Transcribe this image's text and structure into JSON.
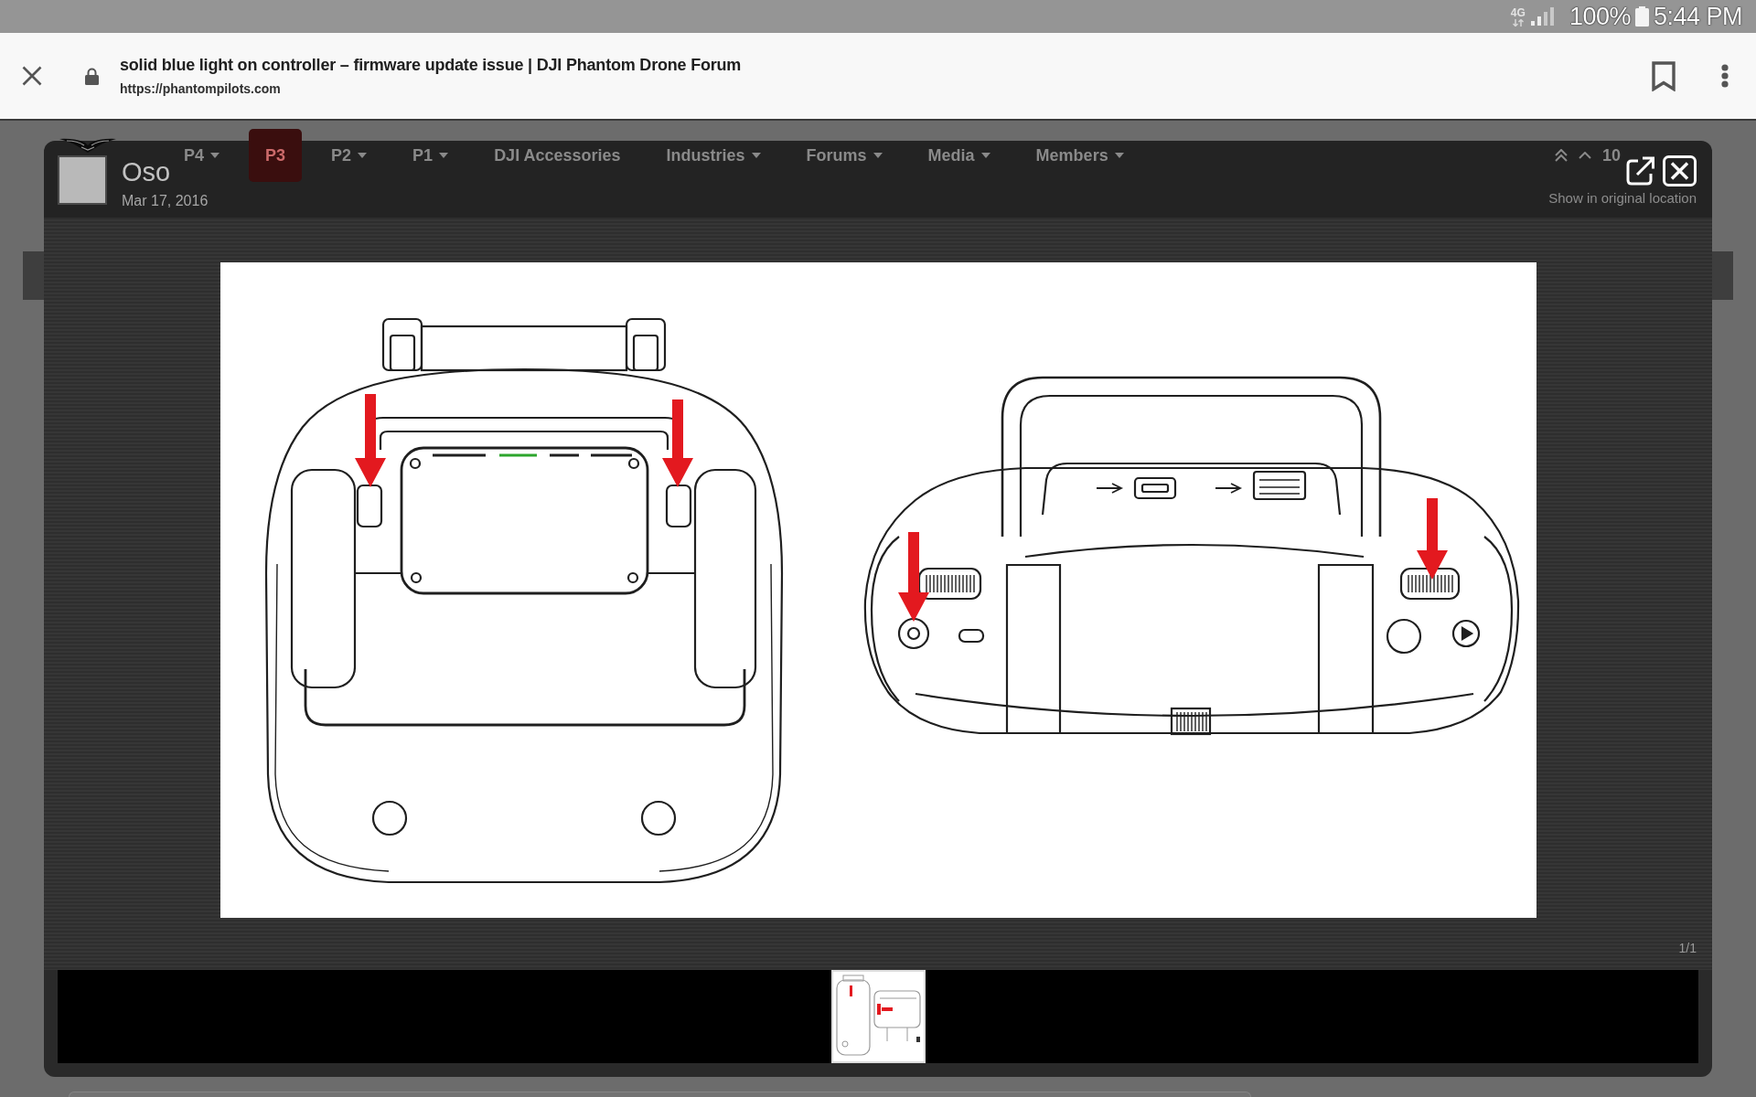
{
  "status_bar": {
    "network": "4G",
    "battery": "100%",
    "time": "5:44 PM"
  },
  "browser_bar": {
    "title": "solid blue light on controller – firmware update issue | DJI Phantom Drone Forum",
    "url": "https://phantompilots.com",
    "secure": true,
    "bookmarked": false
  },
  "page_behind": {
    "nav": [
      {
        "label": "P4",
        "dropdown": true,
        "selected": false
      },
      {
        "label": "P3",
        "dropdown": false,
        "selected": true
      },
      {
        "label": "P2",
        "dropdown": true,
        "selected": false
      },
      {
        "label": "P1",
        "dropdown": true,
        "selected": false
      },
      {
        "label": "DJI Accessories",
        "dropdown": false,
        "selected": false
      },
      {
        "label": "Industries",
        "dropdown": true,
        "selected": false
      },
      {
        "label": "Forums",
        "dropdown": true,
        "selected": false
      },
      {
        "label": "Media",
        "dropdown": true,
        "selected": false
      },
      {
        "label": "Members",
        "dropdown": true,
        "selected": false
      }
    ],
    "pager": "10"
  },
  "lightbox": {
    "author": "Oso",
    "date": "Mar 17, 2016",
    "show_original": "Show in original location",
    "counter": "1/1",
    "thumbnails": [
      {
        "selected": true
      }
    ]
  }
}
